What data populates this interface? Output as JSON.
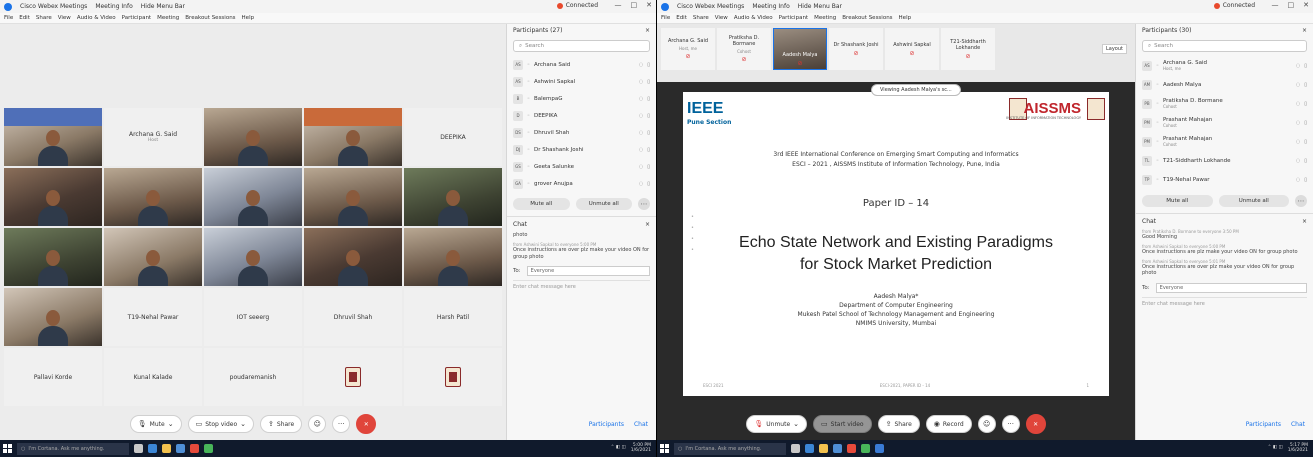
{
  "left": {
    "titlebar": {
      "tabs": [
        "Cisco Webex Meetings",
        "Meeting Info",
        "Hide Menu Bar"
      ],
      "status": "Connected",
      "controls": [
        "—",
        "□",
        "✕"
      ]
    },
    "menu": [
      "File",
      "Edit",
      "Share",
      "View",
      "Audio & Video",
      "Participant",
      "Meeting",
      "Breakout Sessions",
      "Help"
    ],
    "tiles": [
      {
        "kind": "video",
        "variant": "v3",
        "poster": "p1"
      },
      {
        "kind": "name",
        "name": "Archana G. Said",
        "sub": "Host"
      },
      {
        "kind": "video",
        "variant": "v2"
      },
      {
        "kind": "video",
        "variant": "v3",
        "poster": "p2"
      },
      {
        "kind": "name",
        "name": "DEEPIKA",
        "sub": ""
      },
      {
        "kind": "video",
        "variant": "v1"
      },
      {
        "kind": "video",
        "variant": "v2"
      },
      {
        "kind": "video",
        "variant": "v5"
      },
      {
        "kind": "video",
        "variant": "v2"
      },
      {
        "kind": "video",
        "variant": "v4"
      },
      {
        "kind": "video",
        "variant": "v4"
      },
      {
        "kind": "video",
        "variant": "v3"
      },
      {
        "kind": "video",
        "variant": "v5"
      },
      {
        "kind": "video",
        "variant": "v1"
      },
      {
        "kind": "video",
        "variant": "v2"
      },
      {
        "kind": "video",
        "variant": "v3"
      },
      {
        "kind": "name",
        "name": "T19-Nehal Pawar",
        "sub": ""
      },
      {
        "kind": "name",
        "name": "IOT seeerg",
        "sub": ""
      },
      {
        "kind": "name",
        "name": "Dhruvil Shah",
        "sub": ""
      },
      {
        "kind": "name",
        "name": "Harsh Patil",
        "sub": ""
      },
      {
        "kind": "name",
        "name": "Pallavi Korde",
        "sub": ""
      },
      {
        "kind": "name",
        "name": "Kunal Kalade",
        "sub": ""
      },
      {
        "kind": "name",
        "name": "poudaremanish",
        "sub": ""
      },
      {
        "kind": "crest"
      },
      {
        "kind": "crest"
      }
    ],
    "controls": {
      "mute": "Mute",
      "stop_video": "Stop video",
      "share": "Share",
      "participants": "Participants",
      "chat": "Chat"
    },
    "participants_panel": {
      "title": "Participants (27)",
      "search_placeholder": "Search",
      "list": [
        {
          "initials": "AS",
          "name": "Archana Said"
        },
        {
          "initials": "AS",
          "name": "Ashwini Sapkal"
        },
        {
          "initials": "B",
          "name": "BalempaG"
        },
        {
          "initials": "D",
          "name": "DEEPIKA"
        },
        {
          "initials": "DS",
          "name": "Dhruvil Shah"
        },
        {
          "initials": "DJ",
          "name": "Dr Shashank Joshi"
        },
        {
          "initials": "GS",
          "name": "Geeta Salunke"
        },
        {
          "initials": "GA",
          "name": "grover Anujpa"
        }
      ],
      "mute_all": "Mute all",
      "unmute_all": "Unmute all"
    },
    "chat": {
      "title": "Chat",
      "messages": [
        {
          "meta": "",
          "text": "photo"
        },
        {
          "meta": "from Ashwini Sapkal to everyone   5:00 PM",
          "text": "Once instructions are over  plz make your video ON for group photo"
        }
      ],
      "to_label": "To:",
      "to_value": "Everyone",
      "input_placeholder": "Enter chat message here"
    },
    "taskbar": {
      "search": "I'm Cortana. Ask me anything.",
      "time": "5:00 PM",
      "date": "1/6/2021"
    }
  },
  "right": {
    "titlebar": {
      "tabs": [
        "Cisco Webex Meetings",
        "Meeting Info",
        "Hide Menu Bar"
      ],
      "status": "Connected",
      "controls": [
        "—",
        "□",
        "✕"
      ]
    },
    "menu": [
      "File",
      "Edit",
      "Share",
      "View",
      "Audio & Video",
      "Participant",
      "Meeting",
      "Breakout Sessions",
      "Help"
    ],
    "thumbs": [
      {
        "name": "Archana G. Said",
        "sub": "Host, me"
      },
      {
        "name": "Pratiksha D. Bormane",
        "sub": "Cohost"
      },
      {
        "name": "Aadesh Malya",
        "sub": "",
        "video": true
      },
      {
        "name": "Dr Shashank Joshi",
        "sub": ""
      },
      {
        "name": "Ashwini Sapkal",
        "sub": ""
      },
      {
        "name": "T21-Siddharth Lokhande",
        "sub": ""
      }
    ],
    "layout_btn": "Layout",
    "viewing": "Viewing Aadesh Malya's sc...",
    "slide": {
      "ieee": "IEEE",
      "ieee_sub": "Pune Section",
      "aissms": "AISSMS",
      "aissms_sub": "INSTITUTE OF INFORMATION TECHNOLOGY",
      "conf_line1": "3rd IEEE International Conference on Emerging Smart Computing and Informatics",
      "conf_line2": "ESCI – 2021 , AISSMS Institute of Information Technology, Pune, India",
      "paper": "Paper ID – 14",
      "title_line1": "Echo State Network and Existing Paradigms",
      "title_line2": "for Stock Market Prediction",
      "author": "Aadesh Malya*",
      "dept": "Department of Computer Engineering",
      "school": "Mukesh Patel School of Technology Management and Engineering",
      "univ": "NMIMS University, Mumbai",
      "footer_left": "ESCI 2021",
      "footer_mid": "ESCI-2021, PAPER ID - 14",
      "footer_right": "1"
    },
    "controls": {
      "unmute": "Unmute",
      "start_video": "Start video",
      "share": "Share",
      "record": "Record",
      "participants": "Participants",
      "chat": "Chat"
    },
    "participants_panel": {
      "title": "Participants (30)",
      "search_placeholder": "Search",
      "list": [
        {
          "initials": "AS",
          "name": "Archana G. Said",
          "sub": "Host, me"
        },
        {
          "initials": "AM",
          "name": "Aadesh Malya",
          "sub": ""
        },
        {
          "initials": "PB",
          "name": "Pratiksha D. Bormane",
          "sub": "Cohost"
        },
        {
          "initials": "PM",
          "name": "Prashant Mahajan",
          "sub": "Cohost"
        },
        {
          "initials": "PM",
          "name": "Prashant Mahajan",
          "sub": "Cohost"
        },
        {
          "initials": "TL",
          "name": "T21-Siddharth Lokhande",
          "sub": ""
        },
        {
          "initials": "TP",
          "name": "T19-Nehal Pawar",
          "sub": ""
        }
      ],
      "mute_all": "Mute all",
      "unmute_all": "Unmute all"
    },
    "chat": {
      "title": "Chat",
      "messages": [
        {
          "meta": "from Pratiksha D. Bormane to everyone   3:50 PM",
          "text": "Good Morning"
        },
        {
          "meta": "from Ashwini Sapkal to everyone   5:00 PM",
          "text": "Once instructions are plz make your video ON for group photo"
        },
        {
          "meta": "from Ashwini Sapkal to everyone   5:01 PM",
          "text": "Once instructions are over  plz make your video ON for group photo"
        }
      ],
      "to_label": "To:",
      "to_value": "Everyone",
      "input_placeholder": "Enter chat message here"
    },
    "taskbar": {
      "search": "I'm Cortana. Ask me anything.",
      "time": "5:17 PM",
      "date": "1/6/2021"
    }
  },
  "colors": {
    "accent": "#1a73e8",
    "leave": "#e0453b",
    "taskbar": "#101a2c",
    "ieee": "#00629b",
    "aissms": "#c0262d"
  }
}
